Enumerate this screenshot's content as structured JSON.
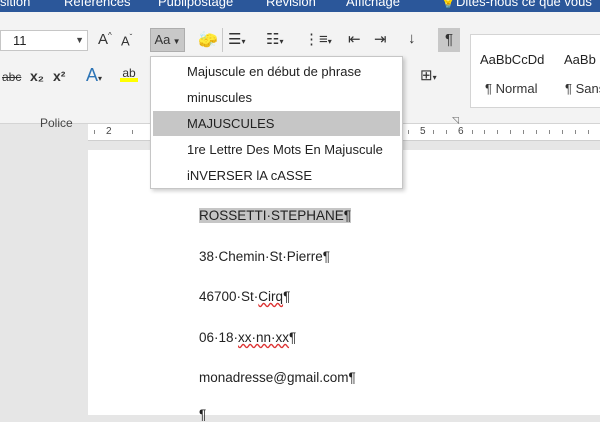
{
  "menubar": {
    "items": [
      "sition",
      "Références",
      "Publipostage",
      "Révision",
      "Affichage",
      "Dites-nous ce que vous"
    ]
  },
  "ribbon": {
    "font_size": "11",
    "grow_font": "A",
    "shrink_font": "A",
    "change_case": "Aa",
    "strikethrough": "abc",
    "subscript": "x₂",
    "superscript": "x²",
    "text_effects": "A",
    "highlight": "ab",
    "group_label": "Police",
    "styles": {
      "preview_1": "AaBbCcDd",
      "preview_2": "AaBb",
      "name_1": "¶ Normal",
      "name_2": "¶ Sans"
    }
  },
  "ruler": {
    "numbers": [
      "2",
      "5",
      "6"
    ]
  },
  "case_menu": {
    "items": [
      "Majuscule en début de phrase",
      "minuscules",
      "MAJUSCULES",
      "1re Lettre Des Mots En Majuscule",
      "iNVERSER lA cASSE"
    ],
    "selected_index": 2
  },
  "document": {
    "lines": [
      "ROSSETTI·STEPHANE¶",
      "38·Chemin·St·Pierre¶",
      "46700·St·Cirq¶",
      "06·18·xx·nn·xx¶",
      "monadresse@gmail.com¶",
      "¶"
    ]
  },
  "colors": {
    "menubar": "#2b579a",
    "selection": "#c6c6c6",
    "highlight_marker": "#ffff00",
    "spell_squiggle": "#dd3333"
  }
}
